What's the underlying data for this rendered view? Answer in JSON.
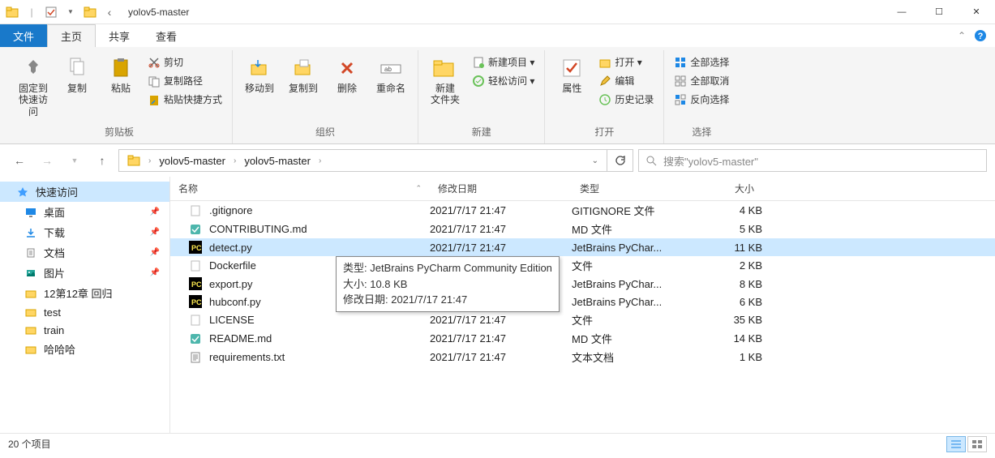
{
  "titlebar": {
    "title": "yolov5-master"
  },
  "winctrl": {
    "min": "—",
    "max": "☐",
    "close": "✕"
  },
  "tabs": {
    "file": "文件",
    "home": "主页",
    "share": "共享",
    "view": "查看"
  },
  "ribbon": {
    "clipboard": {
      "label": "剪贴板",
      "pin": "固定到\n快速访问",
      "copy": "复制",
      "paste": "粘贴",
      "cut": "剪切",
      "copypath": "复制路径",
      "paste_shortcut": "粘贴快捷方式"
    },
    "organize": {
      "label": "组织",
      "moveto": "移动到",
      "copyto": "复制到",
      "delete": "删除",
      "rename": "重命名"
    },
    "new": {
      "label": "新建",
      "newfolder": "新建\n文件夹",
      "newitem": "新建项目 ▾",
      "easyaccess": "轻松访问 ▾"
    },
    "open": {
      "label": "打开",
      "properties": "属性",
      "open": "打开 ▾",
      "edit": "编辑",
      "history": "历史记录"
    },
    "select": {
      "label": "选择",
      "selectall": "全部选择",
      "selectnone": "全部取消",
      "invert": "反向选择"
    }
  },
  "breadcrumb": {
    "seg1": "yolov5-master",
    "seg2": "yolov5-master"
  },
  "search": {
    "placeholder": "搜索\"yolov5-master\""
  },
  "sidebar": {
    "quick": "快速访问",
    "desktop": "桌面",
    "downloads": "下载",
    "documents": "文档",
    "pictures": "图片",
    "ch12": "12第12章 回归",
    "test": "test",
    "train": "train",
    "hahaha": "哈哈哈"
  },
  "columns": {
    "name": "名称",
    "date": "修改日期",
    "type": "类型",
    "size": "大小"
  },
  "files": [
    {
      "name": ".gitignore",
      "date": "2021/7/17 21:47",
      "type": "GITIGNORE 文件",
      "size": "4 KB",
      "icon": "file"
    },
    {
      "name": "CONTRIBUTING.md",
      "date": "2021/7/17 21:47",
      "type": "MD 文件",
      "size": "5 KB",
      "icon": "md"
    },
    {
      "name": "detect.py",
      "date": "2021/7/17 21:47",
      "type": "JetBrains PyChar...",
      "size": "11 KB",
      "icon": "pc",
      "selected": true
    },
    {
      "name": "Dockerfile",
      "date": "",
      "type": "文件",
      "size": "2 KB",
      "icon": "file"
    },
    {
      "name": "export.py",
      "date": "",
      "type": "JetBrains PyChar...",
      "size": "8 KB",
      "icon": "pc"
    },
    {
      "name": "hubconf.py",
      "date": "",
      "type": "JetBrains PyChar...",
      "size": "6 KB",
      "icon": "pc"
    },
    {
      "name": "LICENSE",
      "date": "2021/7/17 21:47",
      "type": "文件",
      "size": "35 KB",
      "icon": "file"
    },
    {
      "name": "README.md",
      "date": "2021/7/17 21:47",
      "type": "MD 文件",
      "size": "14 KB",
      "icon": "md"
    },
    {
      "name": "requirements.txt",
      "date": "2021/7/17 21:47",
      "type": "文本文档",
      "size": "1 KB",
      "icon": "txt"
    }
  ],
  "tooltip": {
    "line1": "类型: JetBrains PyCharm Community Edition",
    "line2": "大小: 10.8 KB",
    "line3": "修改日期: 2021/7/17 21:47"
  },
  "status": {
    "items": "20 个项目"
  }
}
